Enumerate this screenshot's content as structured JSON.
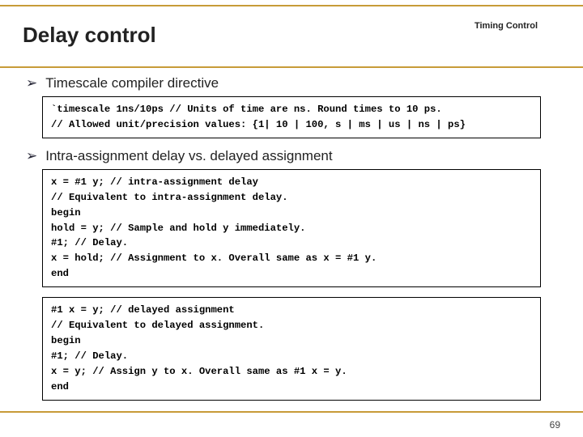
{
  "header": {
    "corner_label": "Timing Control",
    "title": "Delay control"
  },
  "bullets": {
    "b1": "Timescale compiler directive",
    "b2": "Intra-assignment delay vs. delayed assignment"
  },
  "code": {
    "timescale": "`timescale 1ns/10ps // Units of time are ns. Round times to 10 ps.\n// Allowed unit/precision values: {1| 10 | 100, s | ms | us | ns | ps}",
    "intra": "x = #1 y; // intra-assignment delay\n// Equivalent to intra-assignment delay.\nbegin\nhold = y; // Sample and hold y immediately.\n#1; // Delay.\nx = hold; // Assignment to x. Overall same as x = #1 y.\nend",
    "delayed": "#1 x = y; // delayed assignment\n// Equivalent to delayed assignment.\nbegin\n#1; // Delay.\nx = y; // Assign y to x. Overall same as #1 x = y.\nend"
  },
  "footer": {
    "page_num": "69"
  }
}
